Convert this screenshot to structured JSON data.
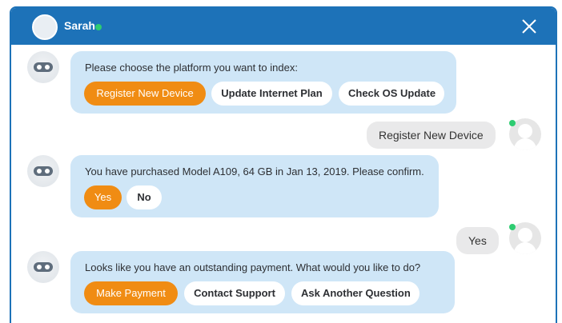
{
  "header": {
    "agent_name": "Sarah",
    "status": "online",
    "close_icon": "close-icon"
  },
  "messages": [
    {
      "from": "bot",
      "text": "Please choose the platform you want to index:",
      "options": [
        "Register New Device",
        "Update Internet Plan",
        "Check OS Update"
      ],
      "selected": "Register New Device"
    },
    {
      "from": "user",
      "text": "Register New Device"
    },
    {
      "from": "bot",
      "text": "You have purchased Model A109, 64 GB in Jan 13, 2019. Please confirm.",
      "options": [
        "Yes",
        "No"
      ],
      "selected": "Yes"
    },
    {
      "from": "user",
      "text": "Yes"
    },
    {
      "from": "bot",
      "text": "Looks like you have an outstanding payment. What would you like to do?",
      "options": [
        "Make Payment",
        "Contact Support",
        "Ask Another Question"
      ],
      "selected": "Make Payment"
    }
  ],
  "colors": {
    "header": "#1d72b8",
    "bot_bubble": "#cfe6f7",
    "user_bubble": "#e9e9ea",
    "accent": "#f08c13",
    "online": "#2ecc71"
  }
}
